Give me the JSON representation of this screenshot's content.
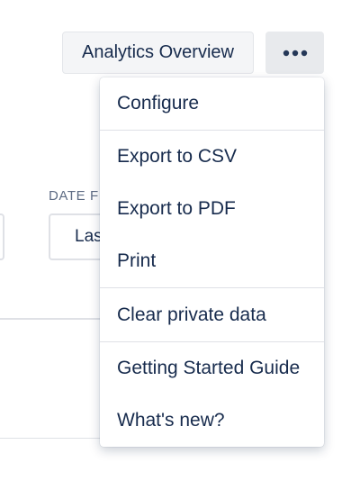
{
  "header": {
    "title_button_label": "Analytics Overview",
    "more_button_icon": "more-horizontal-icon"
  },
  "filters": {
    "date_label": "DATE F",
    "date_value": "Las"
  },
  "menu": {
    "items": [
      {
        "label": "Configure"
      },
      {
        "label": "Export to CSV"
      },
      {
        "label": "Export to PDF"
      },
      {
        "label": "Print"
      },
      {
        "label": "Clear private data"
      },
      {
        "label": "Getting Started Guide"
      },
      {
        "label": "What's new?"
      }
    ]
  },
  "colors": {
    "text": "#172b4d",
    "muted_text": "#5e6c84",
    "button_bg": "#f4f5f7",
    "border": "#dfe1e6"
  }
}
